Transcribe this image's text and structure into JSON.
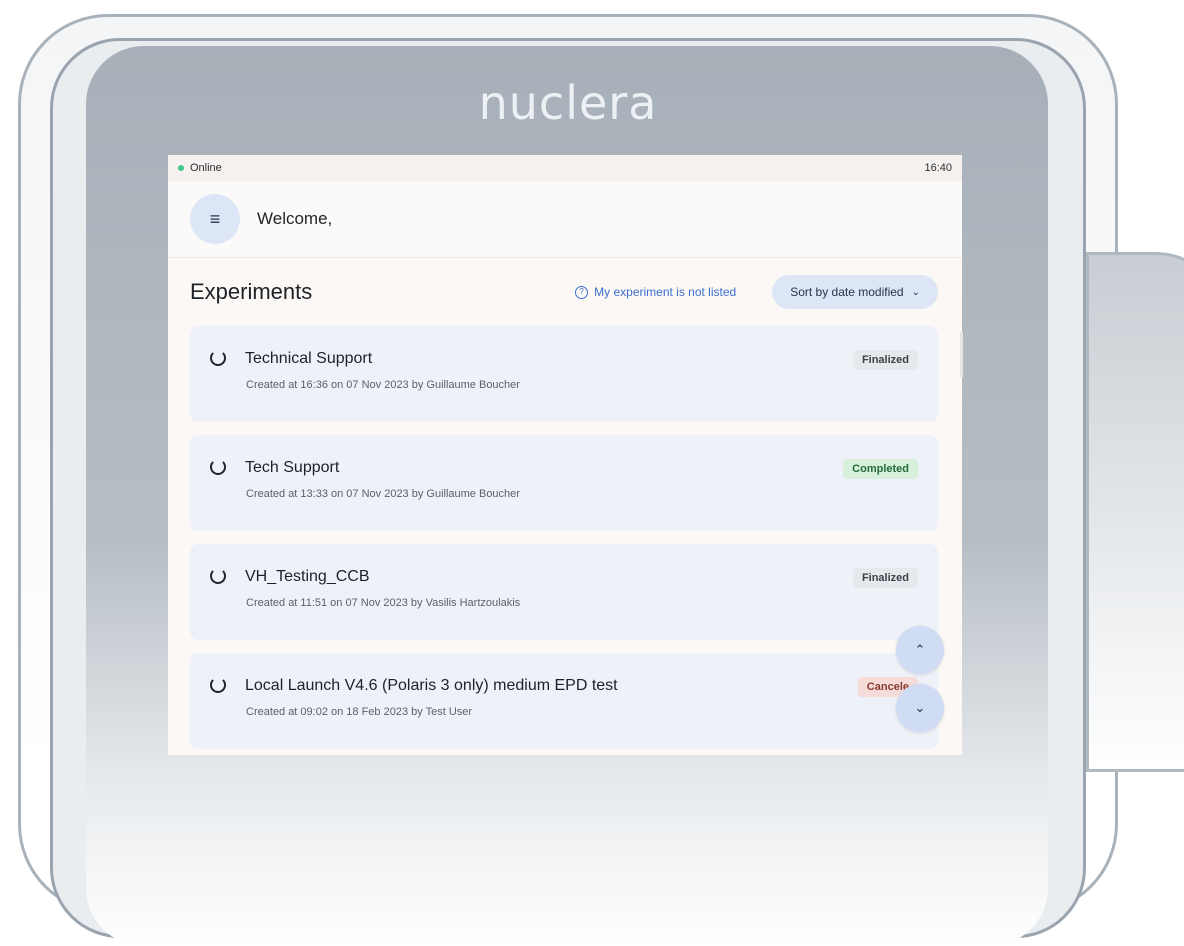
{
  "device": {
    "brand": "nuclera"
  },
  "status": {
    "connection": "Online",
    "time": "16:40",
    "online_color": "#46c58a"
  },
  "header": {
    "welcome": "Welcome,"
  },
  "toolbar": {
    "title": "Experiments",
    "help_link": "My experiment is not listed",
    "sort_label": "Sort by date modified"
  },
  "experiments": [
    {
      "title": "Technical Support",
      "subtitle": "Created at 16:36 on 07 Nov 2023 by Guillaume Boucher",
      "status": "Finalized"
    },
    {
      "title": "Tech Support",
      "subtitle": "Created at 13:33 on 07 Nov 2023 by Guillaume Boucher",
      "status": "Completed"
    },
    {
      "title": "VH_Testing_CCB",
      "subtitle": "Created at 11:51 on 07 Nov 2023 by Vasilis Hartzoulakis",
      "status": "Finalized"
    },
    {
      "title": "Local Launch V4.6 (Polaris 3 only) medium EPD test",
      "subtitle": "Created at 09:02 on 18 Feb 2023 by Test User",
      "status": "Cancele"
    }
  ],
  "icons": {
    "menu": "hamburger-icon",
    "help": "question-circle-icon",
    "sort": "chevron-down-icon",
    "experiment": "spinner-icon",
    "scroll_up": "chevron-up-icon",
    "scroll_down": "chevron-down-icon"
  }
}
